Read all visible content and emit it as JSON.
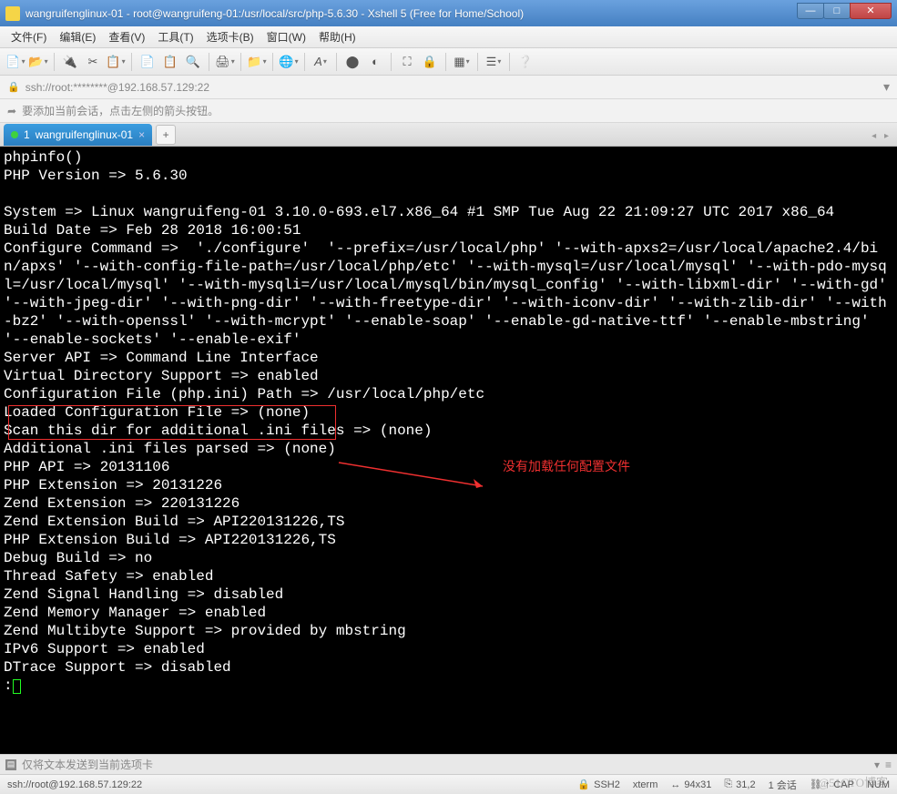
{
  "window": {
    "title": "wangruifenglinux-01 - root@wangruifeng-01:/usr/local/src/php-5.6.30 - Xshell 5 (Free for Home/School)"
  },
  "menubar": {
    "items": [
      "文件(F)",
      "编辑(E)",
      "查看(V)",
      "工具(T)",
      "选项卡(B)",
      "窗口(W)",
      "帮助(H)"
    ]
  },
  "addressbar": {
    "text": "ssh://root:********@192.168.57.129:22"
  },
  "hint": {
    "text": "要添加当前会话，点击左侧的箭头按钮。"
  },
  "tab": {
    "index": "1",
    "label": "wangruifenglinux-01"
  },
  "terminal": {
    "lines": "phpinfo()\nPHP Version => 5.6.30\n\nSystem => Linux wangruifeng-01 3.10.0-693.el7.x86_64 #1 SMP Tue Aug 22 21:09:27 UTC 2017 x86_64\nBuild Date => Feb 28 2018 16:00:51\nConfigure Command =>  './configure'  '--prefix=/usr/local/php' '--with-apxs2=/usr/local/apache2.4/bin/apxs' '--with-config-file-path=/usr/local/php/etc' '--with-mysql=/usr/local/mysql' '--with-pdo-mysql=/usr/local/mysql' '--with-mysqli=/usr/local/mysql/bin/mysql_config' '--with-libxml-dir' '--with-gd' '--with-jpeg-dir' '--with-png-dir' '--with-freetype-dir' '--with-iconv-dir' '--with-zlib-dir' '--with-bz2' '--with-openssl' '--with-mcrypt' '--enable-soap' '--enable-gd-native-ttf' '--enable-mbstring' '--enable-sockets' '--enable-exif'\nServer API => Command Line Interface\nVirtual Directory Support => enabled\nConfiguration File (php.ini) Path => /usr/local/php/etc\nLoaded Configuration File => (none)\nScan this dir for additional .ini files => (none)\nAdditional .ini files parsed => (none)\nPHP API => 20131106\nPHP Extension => 20131226\nZend Extension => 220131226\nZend Extension Build => API220131226,TS\nPHP Extension Build => API220131226,TS\nDebug Build => no\nThread Safety => enabled\nZend Signal Handling => disabled\nZend Memory Manager => enabled\nZend Multibyte Support => provided by mbstring\nIPv6 Support => enabled\nDTrace Support => disabled\n:"
  },
  "annotation": "没有加载任何配置文件",
  "sendbar": {
    "text": "仅将文本发送到当前选项卡"
  },
  "statusbar": {
    "connection": "ssh://root@192.168.57.129:22",
    "protocol": "SSH2",
    "term": "xterm",
    "size": "94x31",
    "cursor": "31,2",
    "sessions": "1 会话",
    "cap": "CAP",
    "num": "NUM"
  },
  "watermark": "@51CTO博客"
}
